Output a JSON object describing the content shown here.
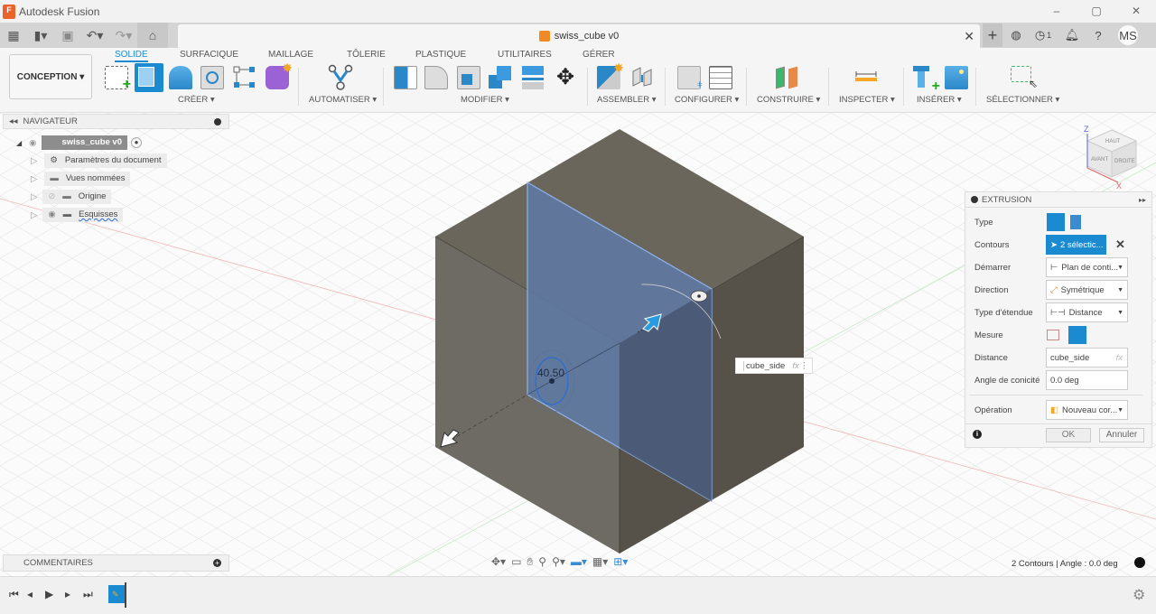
{
  "window": {
    "title": "Autodesk Fusion",
    "app_icon_letter": "F",
    "controls": [
      "–",
      "▢",
      "✕"
    ]
  },
  "appbar": {
    "doc_tab": {
      "title": "swiss_cube v0",
      "close": "✕"
    },
    "jobs_count": "1",
    "user_initials": "MS"
  },
  "ribbon": {
    "workspace": "CONCEPTION ▾",
    "tabs": [
      {
        "label": "SOLIDE",
        "active": true
      },
      {
        "label": "SURFACIQUE"
      },
      {
        "label": "MAILLAGE"
      },
      {
        "label": "TÔLERIE"
      },
      {
        "label": "PLASTIQUE"
      },
      {
        "label": "UTILITAIRES"
      },
      {
        "label": "GÉRER"
      }
    ],
    "groups": [
      {
        "label": "CRÉER ▾"
      },
      {
        "label": "AUTOMATISER ▾"
      },
      {
        "label": "MODIFIER ▾"
      },
      {
        "label": "ASSEMBLER ▾"
      },
      {
        "label": "CONFIGURER ▾"
      },
      {
        "label": "CONSTRUIRE ▾"
      },
      {
        "label": "INSPECTER ▾"
      },
      {
        "label": "INSÉRER ▾"
      },
      {
        "label": "SÉLECTIONNER ▾"
      }
    ]
  },
  "navigator": {
    "title": "NAVIGATEUR",
    "root": "swiss_cube v0",
    "items": [
      {
        "label": "Paramètres du document"
      },
      {
        "label": "Vues nommées"
      },
      {
        "label": "Origine"
      },
      {
        "label": "Esquisses"
      }
    ]
  },
  "comments": {
    "title": "COMMENTAIRES"
  },
  "viewcube": {
    "axis_z": "Z",
    "axis_x": "X",
    "faces": {
      "top": "HAUT",
      "front": "AVANT",
      "right": "DROITE"
    }
  },
  "viewport": {
    "dimension_label": "40.50",
    "distance_input": "cube_side",
    "fx": "fx"
  },
  "extrusion": {
    "title": "EXTRUSION",
    "rows": {
      "type": "Type",
      "contours": "Contours",
      "contours_value": "2 sélectic...",
      "start": "Démarrer",
      "start_value": "Plan de conti...",
      "direction": "Direction",
      "direction_value": "Symétrique",
      "extent_type": "Type d'étendue",
      "extent_value": "Distance",
      "measure": "Mesure",
      "distance": "Distance",
      "distance_value": "cube_side",
      "taper": "Angle de conicité",
      "taper_value": "0.0 deg",
      "operation": "Opération",
      "operation_value": "Nouveau cor..."
    },
    "ok": "OK",
    "cancel": "Annuler"
  },
  "status": {
    "text": "2 Contours | Angle : 0.0 deg"
  }
}
